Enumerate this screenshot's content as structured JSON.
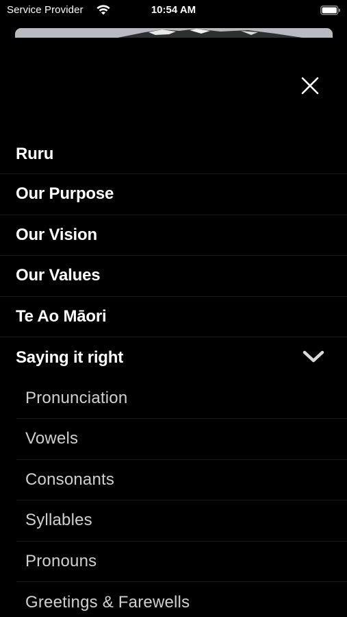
{
  "status_bar": {
    "carrier": "Service Provider",
    "time": "10:54 AM",
    "wifi_icon": "wifi-icon",
    "battery_icon": "battery-icon"
  },
  "menu": {
    "close_icon": "close-icon",
    "items": [
      {
        "label": "Ruru"
      },
      {
        "label": "Our Purpose"
      },
      {
        "label": "Our Vision"
      },
      {
        "label": "Our Values"
      },
      {
        "label": "Te Ao Māori"
      },
      {
        "label": "Saying it right",
        "expanded": true,
        "icon": "chevron-down-icon"
      }
    ],
    "subitems": [
      {
        "label": "Pronunciation"
      },
      {
        "label": "Vowels"
      },
      {
        "label": "Consonants"
      },
      {
        "label": "Syllables"
      },
      {
        "label": "Pronouns"
      },
      {
        "label": "Greetings & Farewells"
      }
    ]
  },
  "colors": {
    "background": "#000000",
    "primary_text": "#ffffff",
    "secondary_text": "#d0d0d0",
    "divider": "#1a1a1a"
  }
}
